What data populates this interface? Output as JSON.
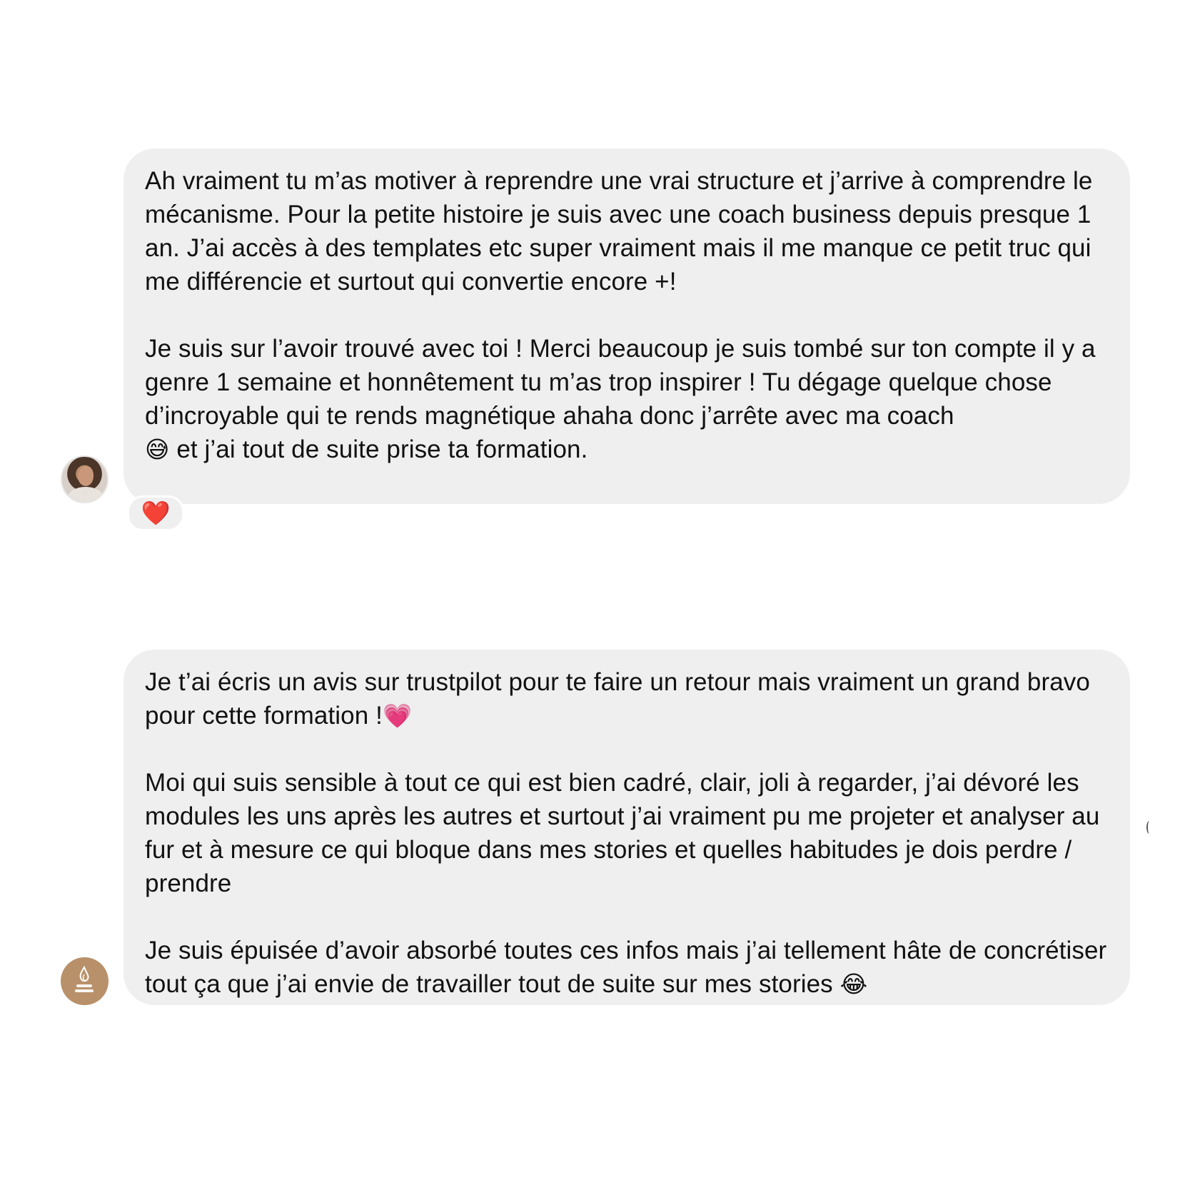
{
  "colors": {
    "background": "#ffffff",
    "bubble": "#efefef",
    "text": "#111111",
    "logo_avatar": "#b8916a"
  },
  "messages": [
    {
      "avatar_icon": "profile-photo",
      "paragraphs": [
        "Ah vraiment tu m’as motiver à reprendre une vrai structure et j’arrive à comprendre le mécanisme. Pour la petite histoire je suis avec une coach business depuis presque 1 an. J’ai accès à des templates etc super vraiment mais il me manque ce petit truc qui me différencie et surtout qui convertie encore +!",
        "Je suis sur l’avoir trouvé avec toi ! Merci beaucoup je suis tombé sur ton compte il y a genre 1 semaine et honnêtement tu m’as trop inspirer ! Tu dégage quelque chose d’incroyable qui te rends magnétique ahaha donc j’arrête avec ma coach"
      ],
      "last_line_emoji": "😅",
      "last_line_text": " et j’ai tout de suite prise ta formation.",
      "reaction": "❤️"
    },
    {
      "avatar_icon": "brand-logo",
      "paragraph_1_text": "Je t’ai écris un avis sur trustpilot pour te faire un retour mais vraiment un grand bravo pour cette formation !",
      "paragraph_1_emoji": "💗",
      "paragraph_2": "Moi qui suis sensible à tout ce qui est bien cadré, clair, joli à regarder, j’ai dévoré les modules les uns après les autres et surtout j’ai vraiment pu me projeter et analyser au fur et à mesure ce qui bloque dans mes stories et quelles habitudes je dois perdre / prendre",
      "paragraph_3_text": "Je suis épuisée d’avoir absorbé toutes ces infos mais j’ai tellement hâte de concrétiser tout ça que j’ai envie de travailler tout de suite sur mes stories ",
      "paragraph_3_emoji": "😂"
    }
  ]
}
